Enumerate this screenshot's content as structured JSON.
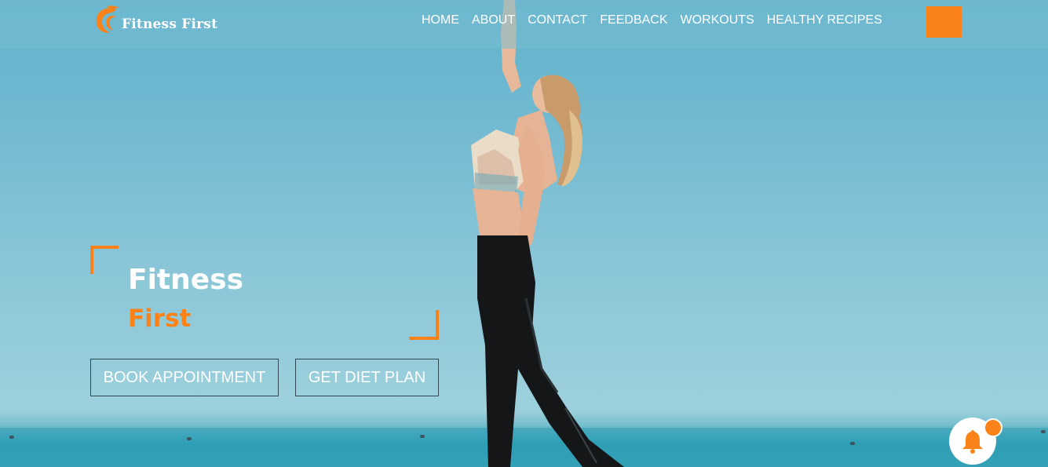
{
  "brand": {
    "name": "Fitness First",
    "accent_color": "#fb8218",
    "logo_icon": "flame-swirl-logo-icon"
  },
  "nav": {
    "items": [
      {
        "label": "HOME"
      },
      {
        "label": "ABOUT"
      },
      {
        "label": "CONTACT"
      },
      {
        "label": "FEEDBACK"
      },
      {
        "label": "WORKOUTS"
      },
      {
        "label": "HEALTHY RECIPES"
      }
    ]
  },
  "hero": {
    "title": "Fitness",
    "subtitle": "First",
    "buttons": {
      "book": "BOOK APPOINTMENT",
      "diet": "GET DIET PLAN"
    }
  },
  "notification": {
    "icon": "bell-icon"
  }
}
